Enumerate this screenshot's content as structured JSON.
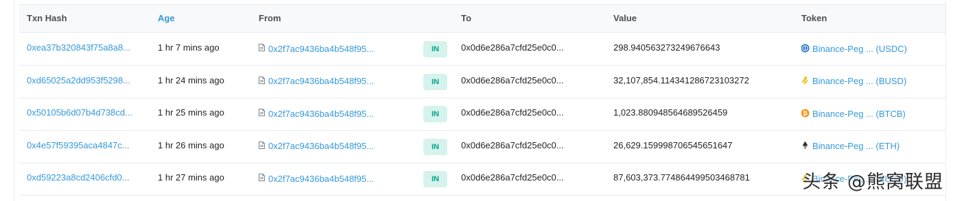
{
  "columns": {
    "txn_hash": "Txn Hash",
    "age": "Age",
    "from": "From",
    "to": "To",
    "value": "Value",
    "token": "Token"
  },
  "rows": [
    {
      "hash": "0xea37b320843f75a8a8...",
      "age": "1 hr 7 mins ago",
      "from": "0x2f7ac9436ba4b548f95...",
      "direction": "IN",
      "to": "0x0d6e286a7cfd25e0c0...",
      "value": "298.940563273249676643",
      "token": "Binance-Peg ... (USDC)",
      "token_icon": "usdc-icon"
    },
    {
      "hash": "0xd65025a2dd953f5298...",
      "age": "1 hr 24 mins ago",
      "from": "0x2f7ac9436ba4b548f95...",
      "direction": "IN",
      "to": "0x0d6e286a7cfd25e0c0...",
      "value": "32,107,854.114341286723103272",
      "token": "Binance-Peg ... (BUSD)",
      "token_icon": "busd-icon"
    },
    {
      "hash": "0x50105b6d07b4d738cd...",
      "age": "1 hr 25 mins ago",
      "from": "0x2f7ac9436ba4b548f95...",
      "direction": "IN",
      "to": "0x0d6e286a7cfd25e0c0...",
      "value": "1,023.880948564689526459",
      "token": "Binance-Peg ... (BTCB)",
      "token_icon": "btcb-icon"
    },
    {
      "hash": "0x4e57f59395aca4847c...",
      "age": "1 hr 26 mins ago",
      "from": "0x2f7ac9436ba4b548f95...",
      "direction": "IN",
      "to": "0x0d6e286a7cfd25e0c0...",
      "value": "26,629.159998706545651647",
      "token": "Binance-Peg ... (ETH)",
      "token_icon": "eth-icon"
    },
    {
      "hash": "0xd59223a8cd2406cfd0...",
      "age": "1 hr 27 mins ago",
      "from": "0x2f7ac9436ba4b548f95...",
      "direction": "IN",
      "to": "0x0d6e286a7cfd25e0c0...",
      "value": "87,603,373.774864499503468781",
      "token": "Binance-Peg ... (BUSD)",
      "token_icon": "busd-icon"
    }
  ],
  "watermark": "头条 @熊窝联盟",
  "colors": {
    "link": "#3498db",
    "badge_bg": "#d5f3ec",
    "badge_text": "#00a186",
    "header_bg": "#f8f9fa"
  }
}
